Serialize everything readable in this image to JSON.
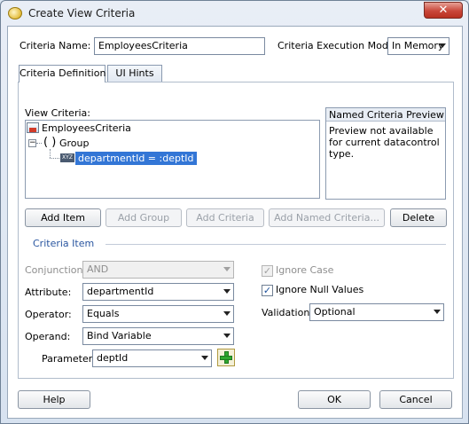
{
  "window": {
    "title": "Create View Criteria"
  },
  "criteria_name": {
    "label": "Criteria Name:",
    "value": "EmployeesCriteria"
  },
  "execution_mode": {
    "label": "Criteria Execution Mode:",
    "value": "In Memory"
  },
  "tabs": [
    {
      "label": "Criteria Definition"
    },
    {
      "label": "UI Hints"
    }
  ],
  "view_criteria": {
    "label": "View Criteria:",
    "root": "EmployeesCriteria",
    "group_symbol": "( )",
    "group": "Group",
    "item_badge": "XYZ",
    "item": "departmentId = :deptId"
  },
  "preview": {
    "title": "Named Criteria Preview",
    "text": "Preview not available for current datacontrol type."
  },
  "buttons": {
    "add_item": "Add Item",
    "add_group": "Add Group",
    "add_criteria": "Add Criteria",
    "add_named": "Add Named Criteria...",
    "delete": "Delete"
  },
  "criteria_item": {
    "section_label": "Criteria Item",
    "conjunction_label": "Conjunction:",
    "conjunction_value": "AND",
    "attribute_label": "Attribute:",
    "attribute_value": "departmentId",
    "operator_label": "Operator:",
    "operator_value": "Equals",
    "operand_label": "Operand:",
    "operand_value": "Bind Variable",
    "parameter_label": "Parameter:",
    "parameter_value": "deptId",
    "ignore_case_label": "Ignore Case",
    "ignore_null_label": "Ignore Null Values",
    "validation_label": "Validation:",
    "validation_value": "Optional"
  },
  "footer": {
    "help": "Help",
    "ok": "OK",
    "cancel": "Cancel"
  },
  "colors": {
    "selection": "#3376d6",
    "add_icon": "#2fa82f"
  }
}
